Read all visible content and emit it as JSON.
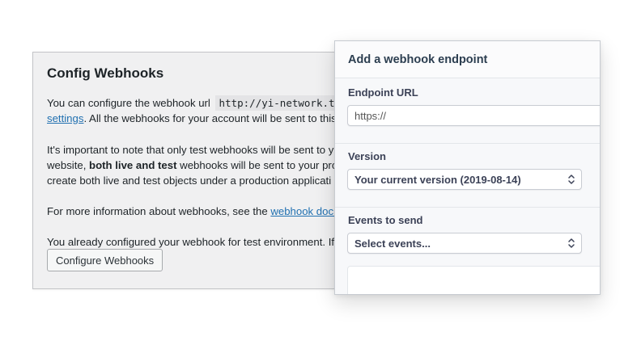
{
  "back_card": {
    "title": "Config Webhooks",
    "p1_line1_text": "You can configure the webhook url",
    "p1_line1_code": "http://yi-network.tes",
    "p1_line2_link": "settings",
    "p1_line2_text": ". All the webhooks for your account will be sent to this",
    "p2_line1": "It's important to note that only test webhooks will be sent to y",
    "p2_line2_pre": "website, ",
    "p2_line2_bold": "both live and test",
    "p2_line2_post": " webhooks will be sent to your prod",
    "p2_line3": "create both live and test objects under a production applicati",
    "p3_text": "For more information about webhooks, see the ",
    "p3_link": "webhook docu",
    "p4_text": "You already configured your webhook for test environment. If",
    "button_label": "Configure Webhooks"
  },
  "modal": {
    "title": "Add a webhook endpoint",
    "endpoint_label": "Endpoint URL",
    "endpoint_value": "https://",
    "version_label": "Version",
    "version_value": "Your current version (2019-08-14)",
    "events_label": "Events to send",
    "events_placeholder": "Select events..."
  },
  "icons": {
    "select_chevron": "chevron-up-down-icon"
  }
}
